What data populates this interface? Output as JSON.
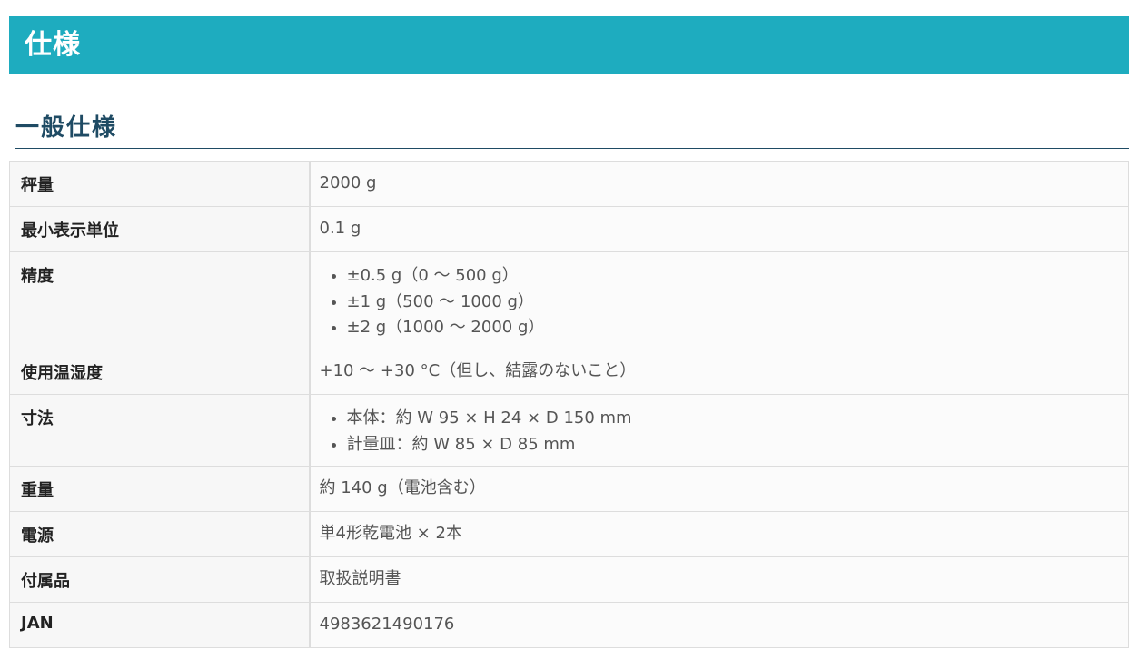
{
  "header": {
    "title": "仕様"
  },
  "section": {
    "heading": "一般仕様"
  },
  "specs": {
    "capacity": {
      "label": "秤量",
      "value": "2000 g"
    },
    "min_display": {
      "label": "最小表示単位",
      "value": "0.1 g"
    },
    "accuracy": {
      "label": "精度",
      "items": [
        "±0.5 g（0 ～ 500 g）",
        "±1 g（500 ～ 1000 g）",
        "±2 g（1000 ～ 2000 g）"
      ]
    },
    "operating_temp": {
      "label": "使用温湿度",
      "value": "+10 ～ +30 °C（但し、結露のないこと）"
    },
    "dimensions": {
      "label": "寸法",
      "items": [
        "本体：約 W 95 × H 24 × D 150 mm",
        "計量皿：約 W 85 × D 85 mm"
      ]
    },
    "weight": {
      "label": "重量",
      "value": "約 140 g（電池含む）"
    },
    "power": {
      "label": "電源",
      "value": "単4形乾電池 × 2本"
    },
    "accessories": {
      "label": "付属品",
      "value": "取扱説明書"
    },
    "jan": {
      "label": "JAN",
      "value": "4983621490176"
    }
  }
}
